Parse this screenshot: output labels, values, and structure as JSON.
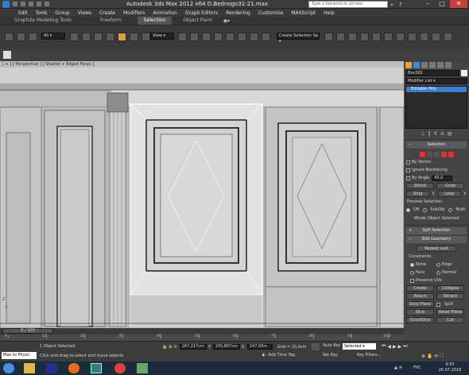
{
  "window": {
    "title": "Autodesk 3ds Max  2012 x64     D.Bednogo31-21.max",
    "search_placeholder": "Type a keyword or phrase",
    "brand_color": "#2a7fd4"
  },
  "menu": [
    "Edit",
    "Tools",
    "Group",
    "Views",
    "Create",
    "Modifiers",
    "Animation",
    "Graph Editors",
    "Rendering",
    "Customize",
    "MAXScript",
    "Help"
  ],
  "ribbon_tabs": {
    "items": [
      "Graphite Modeling Tools",
      "Freeform",
      "Selection",
      "Object Paint"
    ],
    "active": "Selection"
  },
  "toolbar": {
    "selection_filter": "All",
    "reference_coord": "View",
    "named_selection": "Create Selection Se"
  },
  "viewport": {
    "label": "[ + ] [ Perspective ] [ Shaded + Edged Faces ]",
    "axis_x": "x",
    "axis_z": "z"
  },
  "command_panel": {
    "object_name": "Box382",
    "modifier_list": "Modifier List",
    "stack_item": "Editable Poly",
    "selection": {
      "title": "Selection",
      "by_vertex": "By Vertex",
      "ignore_backfacing": "Ignore Backfacing",
      "by_angle": "By Angle",
      "angle_value": "45,0",
      "shrink": "Shrink",
      "grow": "Grow",
      "ring": "Ring",
      "loop": "Loop",
      "preview_title": "Preview Selection",
      "preview_off": "Off",
      "preview_subobj": "SubObj",
      "preview_multi": "Multi",
      "status": "Whole Object Selected"
    },
    "soft_selection": "Soft Selection",
    "edit_geometry": {
      "title": "Edit Geometry",
      "repeat_last": "Repeat Last",
      "constraints": "Constraints",
      "none": "None",
      "edge": "Edge",
      "face": "Face",
      "normal": "Normal",
      "preserve_uvs": "Preserve UVs",
      "create": "Create",
      "collapse": "Collapse",
      "attach": "Attach",
      "detach": "Detach",
      "slice_plane": "Slice Plane",
      "split": "Split",
      "slice": "Slice",
      "reset_plane": "Reset Plane",
      "quickslice": "QuickSlice",
      "cut": "Cut"
    }
  },
  "timeline": {
    "frame_counter": "0 / 100",
    "ticks": [
      "0",
      "10",
      "20",
      "30",
      "40",
      "50",
      "60",
      "70",
      "80",
      "90",
      "100"
    ]
  },
  "status": {
    "maxscript": "Max to Physc",
    "selected": "1 Object Selected",
    "prompt": "Click and drag to select and move objects",
    "x_label": "X:",
    "x_value": "167,217cm",
    "y_label": "Y:",
    "y_value": "155,867cm",
    "z_label": "Z:",
    "z_value": "247,00m",
    "grid": "Grid = 10,0cm",
    "auto_key": "Auto Key",
    "set_key": "Set Key",
    "selected_dropdown": "Selected",
    "key_filters": "Key Filters...",
    "add_time_tag": "Add Time Tag"
  },
  "taskbar": {
    "language": "РУС",
    "time": "9:55",
    "date": "26.07.2018"
  }
}
